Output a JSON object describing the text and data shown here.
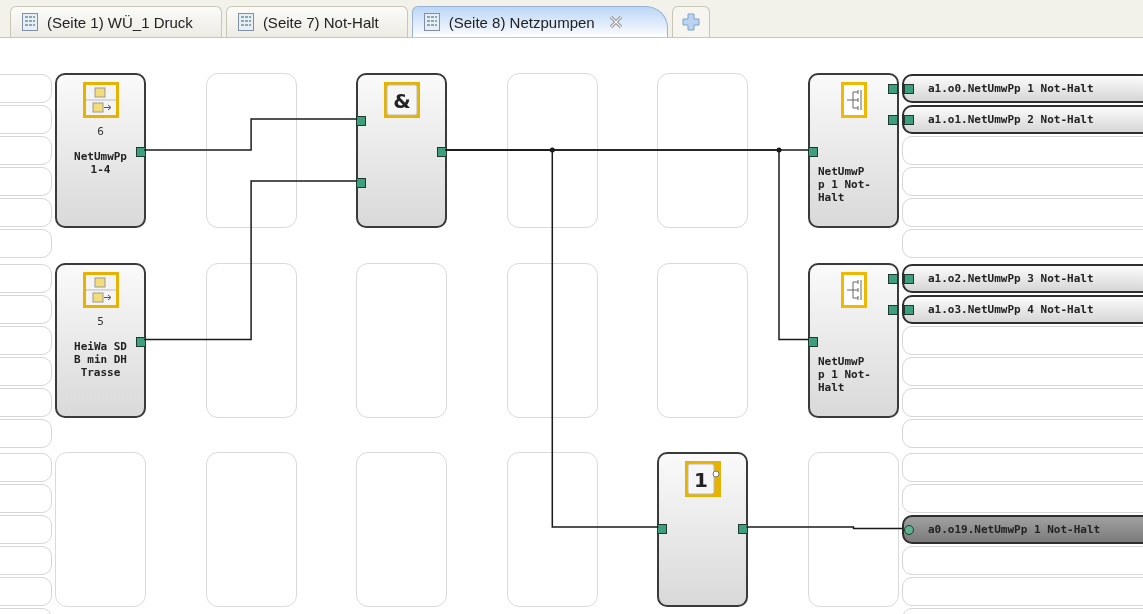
{
  "tabs": [
    {
      "label": "(Seite 1) WÜ_1 Druck",
      "selected": false
    },
    {
      "label": "(Seite 7) Not-Halt",
      "selected": false
    },
    {
      "label": "(Seite 8) Netzpumpen",
      "selected": true
    }
  ],
  "input_slots": [
    {
      "kind": "empty"
    },
    {
      "kind": "empty"
    },
    {
      "kind": "empty"
    },
    {
      "kind": "empty"
    },
    {
      "kind": "empty"
    },
    {
      "kind": "empty"
    },
    {
      "kind": "empty"
    },
    {
      "kind": "empty"
    },
    {
      "kind": "empty"
    },
    {
      "kind": "empty"
    },
    {
      "kind": "empty"
    },
    {
      "kind": "empty"
    },
    {
      "kind": "empty"
    },
    {
      "kind": "empty"
    },
    {
      "kind": "empty"
    },
    {
      "kind": "empty"
    },
    {
      "kind": "empty"
    },
    {
      "kind": "empty"
    }
  ],
  "grid": [
    {
      "cells": [
        {
          "kind": "input",
          "number": "6",
          "label": "NetUmwPp 1-4"
        },
        {
          "kind": "empty"
        },
        {
          "kind": "and",
          "symbol": "&"
        },
        {
          "kind": "empty"
        },
        {
          "kind": "empty"
        },
        {
          "kind": "split",
          "label": "NetUmwPp 1 Not-Halt"
        }
      ]
    },
    {
      "cells": [
        {
          "kind": "input",
          "number": "5",
          "label": "HeiWa SDB min DH Trasse"
        },
        {
          "kind": "empty"
        },
        {
          "kind": "empty"
        },
        {
          "kind": "empty"
        },
        {
          "kind": "empty"
        },
        {
          "kind": "split",
          "label": "NetUmwPp 1 Not-Halt"
        }
      ]
    },
    {
      "cells": [
        {
          "kind": "empty"
        },
        {
          "kind": "empty"
        },
        {
          "kind": "empty"
        },
        {
          "kind": "empty"
        },
        {
          "kind": "not",
          "symbol": "1"
        },
        {
          "kind": "empty"
        }
      ]
    }
  ],
  "output_slots": [
    {
      "kind": "output",
      "label": "a1.o0.NetUmwPp 1 Not-Halt"
    },
    {
      "kind": "output",
      "label": "a1.o1.NetUmwPp 2 Not-Halt"
    },
    {
      "kind": "empty"
    },
    {
      "kind": "empty"
    },
    {
      "kind": "empty"
    },
    {
      "kind": "empty"
    },
    {
      "kind": "output",
      "label": "a1.o2.NetUmwPp 3 Not-Halt"
    },
    {
      "kind": "output",
      "label": "a1.o3.NetUmwPp 4 Not-Halt"
    },
    {
      "kind": "empty"
    },
    {
      "kind": "empty"
    },
    {
      "kind": "empty"
    },
    {
      "kind": "empty"
    },
    {
      "kind": "empty"
    },
    {
      "kind": "empty"
    },
    {
      "kind": "output_inverted",
      "label": "a0.o19.NetUmwPp 1 Not-Halt"
    },
    {
      "kind": "empty"
    },
    {
      "kind": "empty"
    },
    {
      "kind": "empty"
    }
  ]
}
